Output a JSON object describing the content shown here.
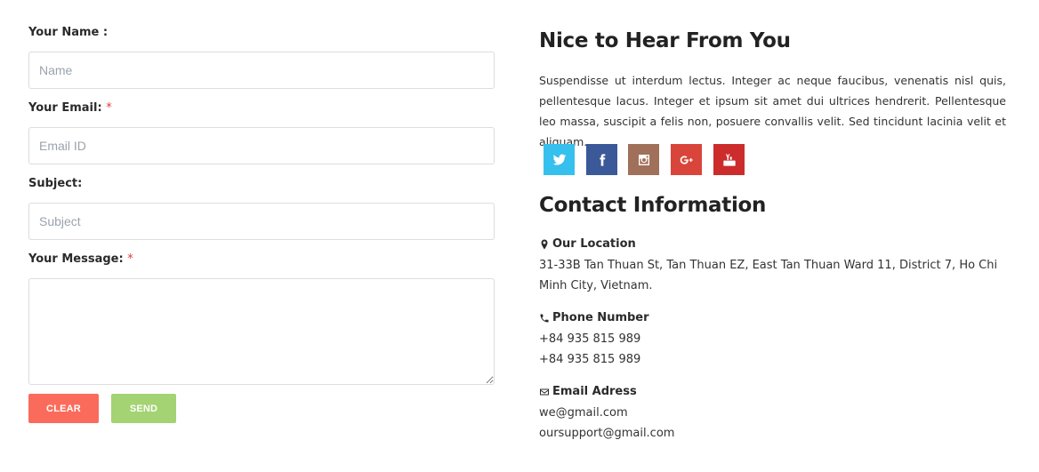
{
  "form": {
    "name_label": "Your Name :",
    "name_placeholder": "Name",
    "email_label": "Your Email:",
    "email_required": "*",
    "email_placeholder": "Email ID",
    "subject_label": "Subject:",
    "subject_placeholder": "Subject",
    "message_label": "Your Message:",
    "message_required": "*",
    "clear_label": "CLEAR",
    "send_label": "SEND"
  },
  "info": {
    "heading": "Nice to Hear From You",
    "intro": "Suspendisse ut interdum lectus. Integer ac neque faucibus, venenatis nisl quis, pellentesque lacus. Integer et ipsum sit amet dui ultrices hendrerit. Pellentesque leo massa, suscipit a felis non, posuere convallis velit. Sed tincidunt lacinia velit et aliquam.",
    "socials": [
      {
        "name": "twitter",
        "icon": "twitter-icon",
        "color": "#36c0ee"
      },
      {
        "name": "facebook",
        "icon": "facebook-icon",
        "color": "#3b5998"
      },
      {
        "name": "instagram",
        "icon": "instagram-icon",
        "color": "#a0705a"
      },
      {
        "name": "google-plus",
        "icon": "google-plus-icon",
        "color": "#d9453a"
      },
      {
        "name": "youtube",
        "icon": "youtube-icon",
        "color": "#cc2c2c"
      }
    ]
  },
  "contact": {
    "heading": "Contact Information",
    "location_title": "Our Location",
    "location_icon": "map-marker-icon",
    "location_text": "31-33B Tan Thuan St, Tan Thuan EZ, East Tan Thuan Ward 11, District 7, Ho Chi Minh City, Vietnam.",
    "phone_title": "Phone Number",
    "phone_icon": "phone-icon",
    "phones": [
      "+84 935 815 989",
      "+84 935 815 989"
    ],
    "email_title": "Email Adress",
    "email_icon": "envelope-icon",
    "emails": [
      "we@gmail.com",
      "oursupport@gmail.com"
    ]
  }
}
